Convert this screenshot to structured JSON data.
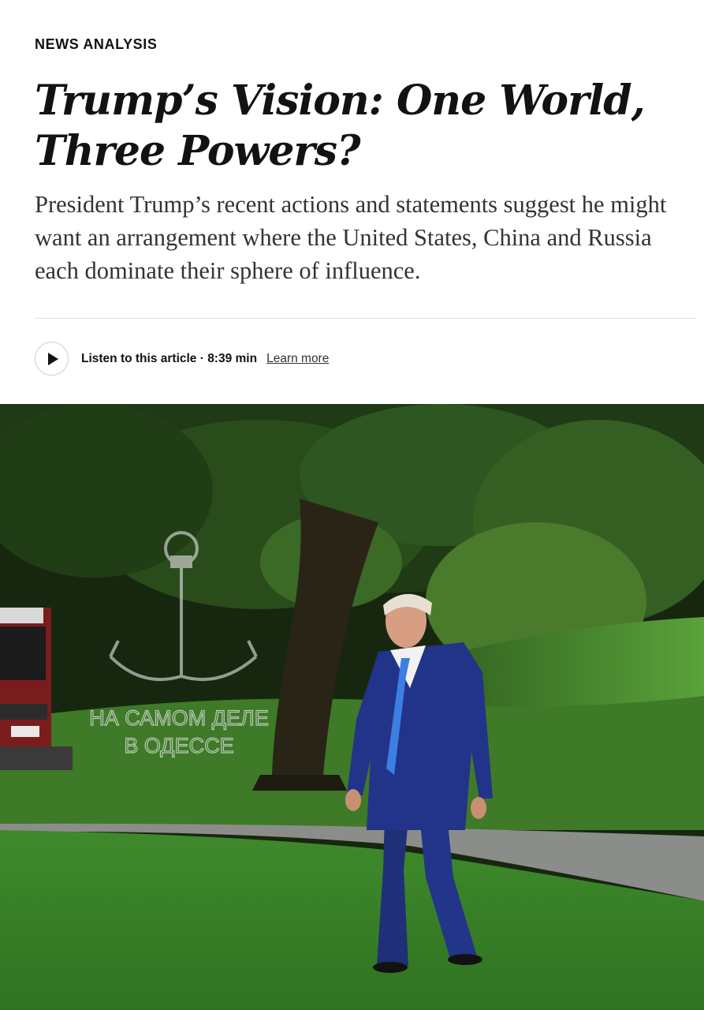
{
  "article": {
    "kicker": "NEWS ANALYSIS",
    "headline": "Trump’s Vision: One World, Three Powers?",
    "summary": "President Trump’s recent actions and statements suggest he might want an arrangement where the United States, China and Russia each dominate their sphere of influence."
  },
  "audio": {
    "play_icon": "play-icon",
    "listen_label": "Listen to this article · 8:39 min",
    "learn_more": "Learn more"
  },
  "photo": {
    "watermark_line1": "НА САМОМ ДЕЛЕ",
    "watermark_line2": "В ОДЕССЕ",
    "watermark_icon": "anchor-icon"
  }
}
